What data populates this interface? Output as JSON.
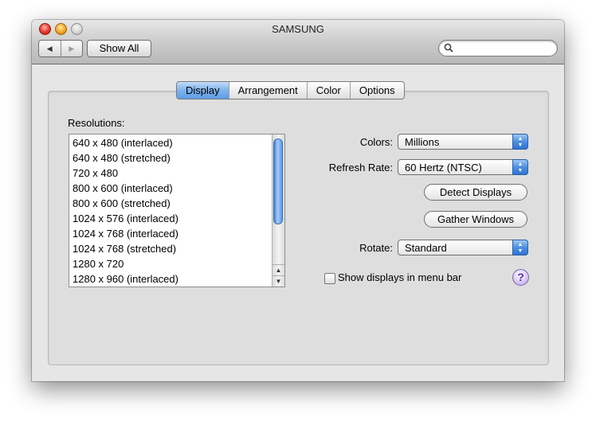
{
  "window": {
    "title": "SAMSUNG"
  },
  "toolbar": {
    "back_glyph": "◀",
    "forward_glyph": "▶",
    "show_all_label": "Show All",
    "search_value": ""
  },
  "tabs": [
    {
      "label": "Display",
      "selected": true
    },
    {
      "label": "Arrangement",
      "selected": false
    },
    {
      "label": "Color",
      "selected": false
    },
    {
      "label": "Options",
      "selected": false
    }
  ],
  "resolutions": {
    "label": "Resolutions:",
    "items": [
      "640 x 480 (interlaced)",
      "640 x 480 (stretched)",
      "720 x 480",
      "800 x 600 (interlaced)",
      "800 x 600 (stretched)",
      "1024 x 576 (interlaced)",
      "1024 x 768 (interlaced)",
      "1024 x 768 (stretched)",
      "1280 x 720",
      "1280 x 960 (interlaced)"
    ]
  },
  "settings": {
    "colors_label": "Colors:",
    "colors_value": "Millions",
    "refresh_label": "Refresh Rate:",
    "refresh_value": "60 Hertz (NTSC)",
    "detect_button": "Detect Displays",
    "gather_button": "Gather Windows",
    "rotate_label": "Rotate:",
    "rotate_value": "Standard",
    "menubar_checkbox_label": "Show displays in menu bar",
    "menubar_checked": false,
    "help_glyph": "?"
  },
  "colors": {
    "accent": "#5d9de6",
    "window_bg": "#e6e6e6"
  }
}
